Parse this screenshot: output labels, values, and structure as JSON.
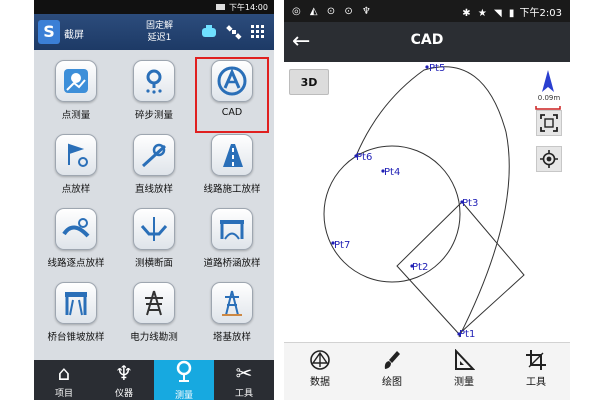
{
  "left_phone": {
    "status": {
      "time": "下午14:00"
    },
    "header": {
      "title": "截屏",
      "fix_status": "固定解",
      "delay": "延迟1"
    },
    "tiles": [
      {
        "label": "点测量",
        "icon": "point-survey-icon"
      },
      {
        "label": "碎步测量",
        "icon": "detail-survey-icon"
      },
      {
        "label": "CAD",
        "icon": "cad-icon",
        "selected": true
      },
      {
        "label": "点放样",
        "icon": "point-stakeout-icon"
      },
      {
        "label": "直线放样",
        "icon": "line-stakeout-icon"
      },
      {
        "label": "线路施工放样",
        "icon": "road-construction-icon"
      },
      {
        "label": "线路逐点放样",
        "icon": "road-point-stakeout-icon"
      },
      {
        "label": "测横断面",
        "icon": "cross-section-icon"
      },
      {
        "label": "道路桥涵放样",
        "icon": "bridge-culvert-icon"
      },
      {
        "label": "桥台锥坡放样",
        "icon": "abutment-slope-icon"
      },
      {
        "label": "电力线勘测",
        "icon": "power-line-icon"
      },
      {
        "label": "塔基放样",
        "icon": "tower-base-icon"
      }
    ],
    "tabbar": [
      {
        "label": "项目",
        "icon": "home-icon"
      },
      {
        "label": "仪器",
        "icon": "instrument-icon"
      },
      {
        "label": "测量",
        "icon": "survey-pin-icon",
        "active": true
      },
      {
        "label": "工具",
        "icon": "tools-icon"
      }
    ]
  },
  "right_phone": {
    "status": {
      "time": "下午2:03"
    },
    "appbar": {
      "title": "CAD"
    },
    "canvas": {
      "button_3d": "3D",
      "scale_text": "0.09m",
      "points": [
        {
          "name": "Pt5"
        },
        {
          "name": "Pt6"
        },
        {
          "name": "Pt4"
        },
        {
          "name": "Pt3"
        },
        {
          "name": "Pt7"
        },
        {
          "name": "Pt2"
        },
        {
          "name": "Pt1"
        }
      ]
    },
    "bottom_tabs": [
      {
        "label": "数据",
        "icon": "data-icon"
      },
      {
        "label": "绘图",
        "icon": "brush-icon"
      },
      {
        "label": "测量",
        "icon": "measure-triangle-icon"
      },
      {
        "label": "工具",
        "icon": "crop-tool-icon"
      }
    ]
  }
}
